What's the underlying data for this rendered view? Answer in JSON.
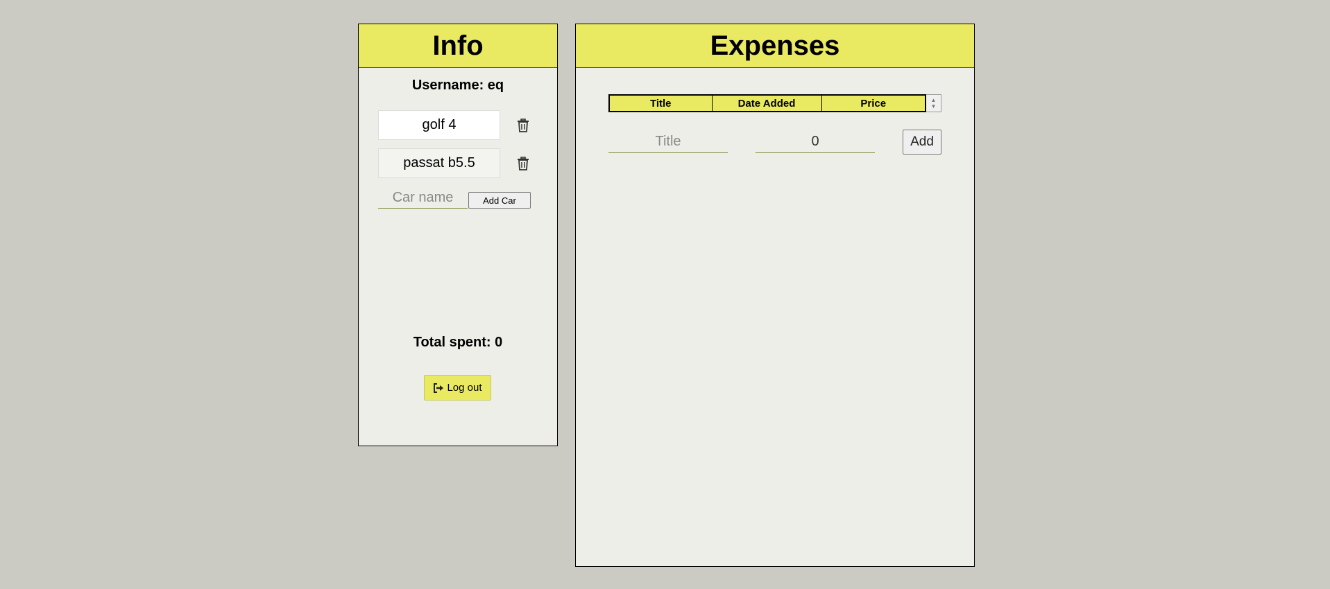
{
  "info": {
    "title": "Info",
    "username_text": "Username: eq",
    "cars": [
      {
        "name": "golf 4"
      },
      {
        "name": "passat b5.5"
      }
    ],
    "car_name_placeholder": "Car name",
    "add_car_label": "Add Car",
    "total_spent_text": "Total spent: 0",
    "logout_label": "Log out"
  },
  "expenses": {
    "title": "Expenses",
    "columns": [
      "Title",
      "Date Added",
      "Price"
    ],
    "title_placeholder": "Title",
    "price_value": "0",
    "add_label": "Add"
  },
  "colors": {
    "accent": "#e9e962",
    "panel_bg": "#eeeee8",
    "page_bg": "#cbcbc3"
  },
  "icons": {
    "trash": "trash-icon",
    "logout": "sign-out-icon"
  }
}
